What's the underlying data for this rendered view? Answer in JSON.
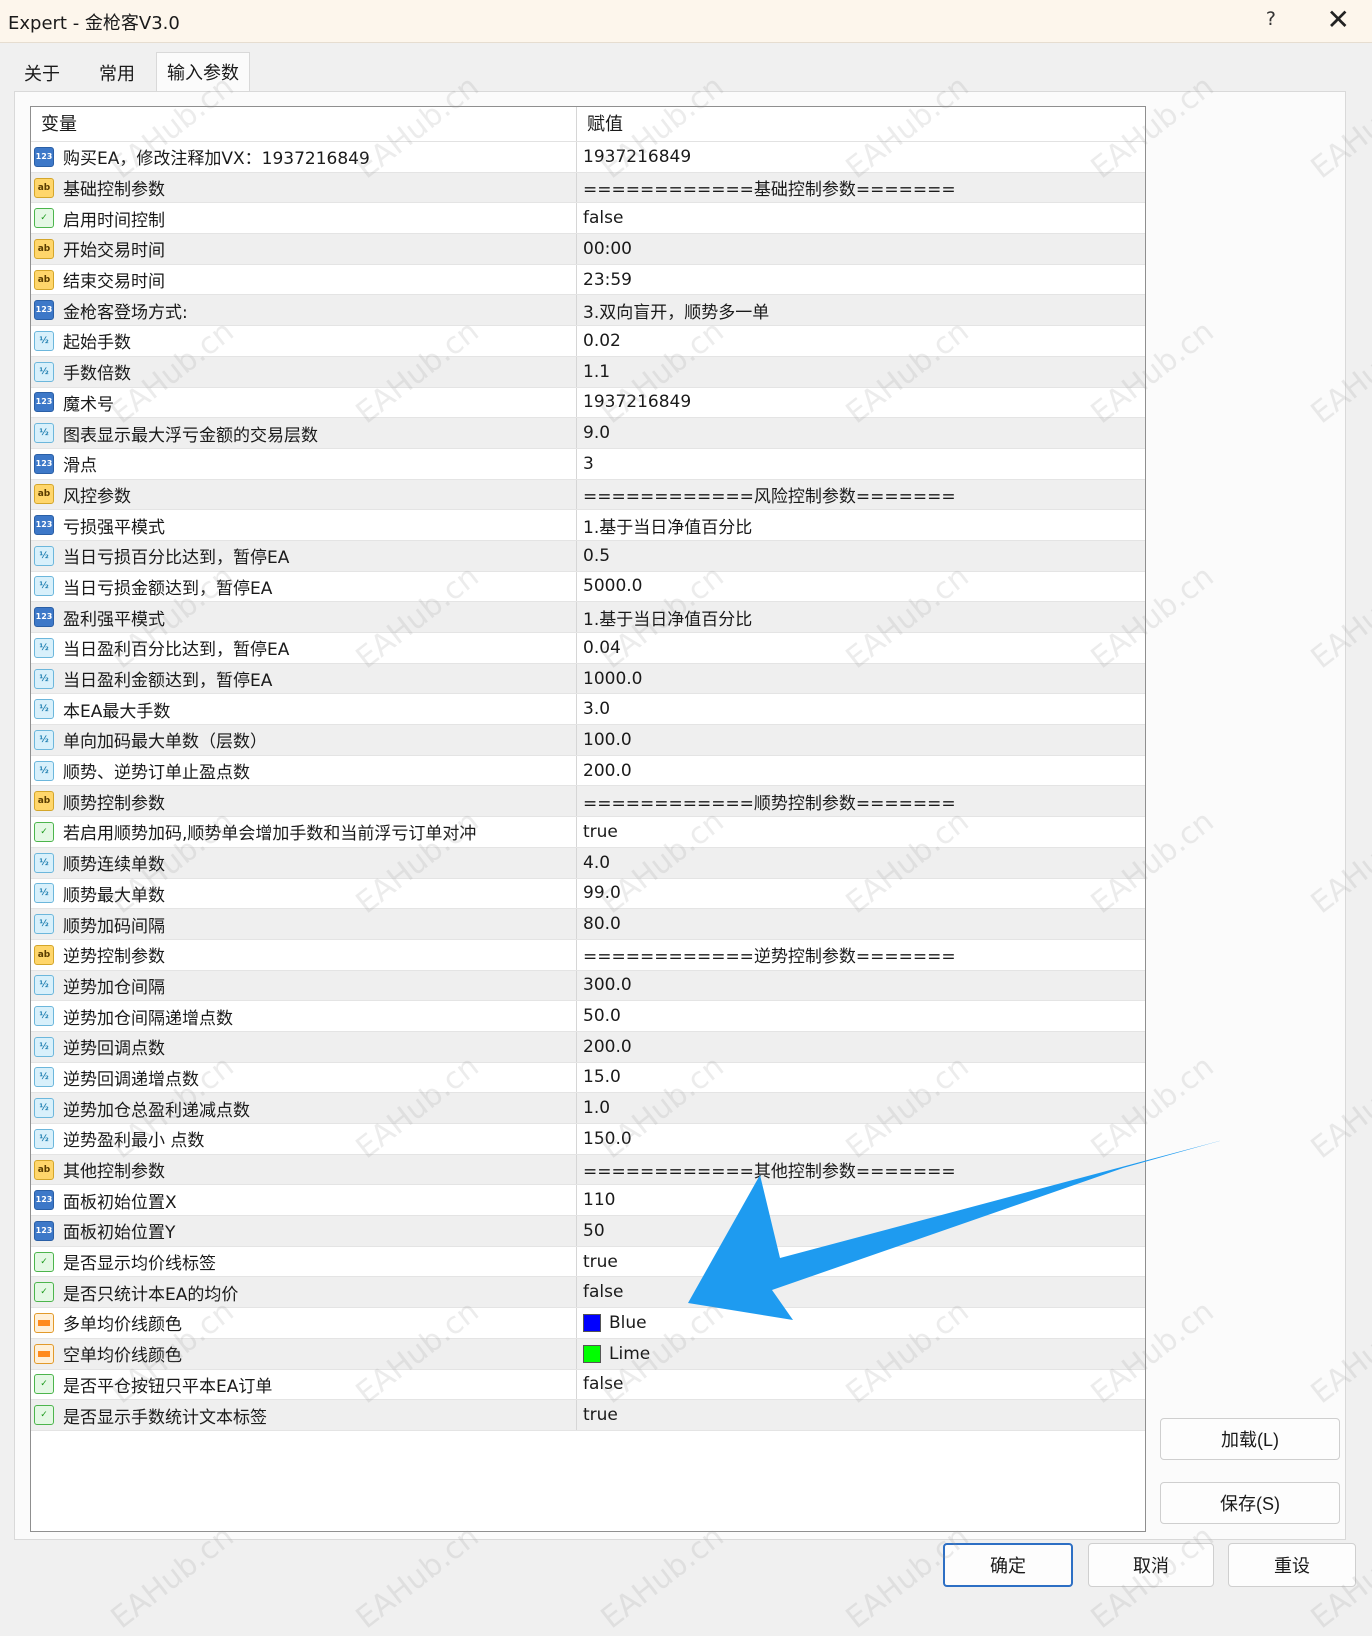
{
  "window": {
    "title": "Expert - 金枪客V3.0",
    "help_label": "?",
    "close_label": "✕"
  },
  "tabs": [
    {
      "label": "关于"
    },
    {
      "label": "常用"
    },
    {
      "label": "输入参数"
    }
  ],
  "grid": {
    "headers": {
      "variable": "变量",
      "value": "赋值"
    },
    "rows": [
      {
        "type": "int",
        "name": "购买EA，修改注释加VX：1937216849",
        "value": "1937216849"
      },
      {
        "type": "str",
        "name": "基础控制参数",
        "value": "============基础控制参数======="
      },
      {
        "type": "bool",
        "name": "启用时间控制",
        "value": "false"
      },
      {
        "type": "str",
        "name": "开始交易时间",
        "value": "00:00"
      },
      {
        "type": "str",
        "name": "结束交易时间",
        "value": "23:59"
      },
      {
        "type": "int",
        "name": "金枪客登场方式:",
        "value": "3.双向盲开，顺势多一单"
      },
      {
        "type": "dbl",
        "name": "起始手数",
        "value": "0.02"
      },
      {
        "type": "dbl",
        "name": "手数倍数",
        "value": "1.1"
      },
      {
        "type": "int",
        "name": "魔术号",
        "value": "1937216849"
      },
      {
        "type": "dbl",
        "name": "图表显示最大浮亏金额的交易层数",
        "value": "9.0"
      },
      {
        "type": "int",
        "name": "滑点",
        "value": "3"
      },
      {
        "type": "str",
        "name": "风控参数",
        "value": "============风险控制参数======="
      },
      {
        "type": "int",
        "name": "亏损强平模式",
        "value": "1.基于当日净值百分比"
      },
      {
        "type": "dbl",
        "name": "当日亏损百分比达到，暂停EA",
        "value": "0.5"
      },
      {
        "type": "dbl",
        "name": "当日亏损金额达到，暂停EA",
        "value": "5000.0"
      },
      {
        "type": "int",
        "name": "盈利强平模式",
        "value": "1.基于当日净值百分比"
      },
      {
        "type": "dbl",
        "name": "当日盈利百分比达到，暂停EA",
        "value": "0.04"
      },
      {
        "type": "dbl",
        "name": "当日盈利金额达到，暂停EA",
        "value": "1000.0"
      },
      {
        "type": "dbl",
        "name": "本EA最大手数",
        "value": "3.0"
      },
      {
        "type": "dbl",
        "name": "单向加码最大单数（层数）",
        "value": "100.0"
      },
      {
        "type": "dbl",
        "name": "顺势、逆势订单止盈点数",
        "value": "200.0"
      },
      {
        "type": "str",
        "name": "顺势控制参数",
        "value": "============顺势控制参数======="
      },
      {
        "type": "bool",
        "name": "若启用顺势加码,顺势单会增加手数和当前浮亏订单对冲",
        "value": "true"
      },
      {
        "type": "dbl",
        "name": "顺势连续单数",
        "value": "4.0"
      },
      {
        "type": "dbl",
        "name": "顺势最大单数",
        "value": "99.0"
      },
      {
        "type": "dbl",
        "name": "顺势加码间隔",
        "value": "80.0"
      },
      {
        "type": "str",
        "name": "逆势控制参数",
        "value": "============逆势控制参数======="
      },
      {
        "type": "dbl",
        "name": "逆势加仓间隔",
        "value": "300.0"
      },
      {
        "type": "dbl",
        "name": "逆势加仓间隔递增点数",
        "value": "50.0"
      },
      {
        "type": "dbl",
        "name": "逆势回调点数",
        "value": "200.0"
      },
      {
        "type": "dbl",
        "name": "逆势回调递增点数",
        "value": "15.0"
      },
      {
        "type": "dbl",
        "name": "逆势加仓总盈利递减点数",
        "value": "1.0"
      },
      {
        "type": "dbl",
        "name": "逆势盈利最小 点数",
        "value": "150.0"
      },
      {
        "type": "str",
        "name": "其他控制参数",
        "value": "============其他控制参数======="
      },
      {
        "type": "int",
        "name": "面板初始位置X",
        "value": "110"
      },
      {
        "type": "int",
        "name": "面板初始位置Y",
        "value": "50"
      },
      {
        "type": "bool",
        "name": "是否显示均价线标签",
        "value": "true"
      },
      {
        "type": "bool",
        "name": "是否只统计本EA的均价",
        "value": "false"
      },
      {
        "type": "color",
        "name": "多单均价线颜色",
        "value": "Blue",
        "swatch": "#0000ff"
      },
      {
        "type": "color",
        "name": "空单均价线颜色",
        "value": "Lime",
        "swatch": "#00ff00"
      },
      {
        "type": "bool",
        "name": "是否平仓按钮只平本EA订单",
        "value": "false"
      },
      {
        "type": "bool",
        "name": "是否显示手数统计文本标签",
        "value": "true"
      }
    ]
  },
  "type_icons": {
    "int": "123",
    "str": "ab",
    "dbl": "½",
    "bool": "✓",
    "color": ""
  },
  "buttons": {
    "load": "加载(L)",
    "save": "保存(S)",
    "ok": "确定",
    "cancel": "取消",
    "reset": "重设"
  },
  "watermark": "EAHub.cn",
  "colors": {
    "arrow": "#1e9bf0",
    "primary_border": "#2d6fc4"
  }
}
